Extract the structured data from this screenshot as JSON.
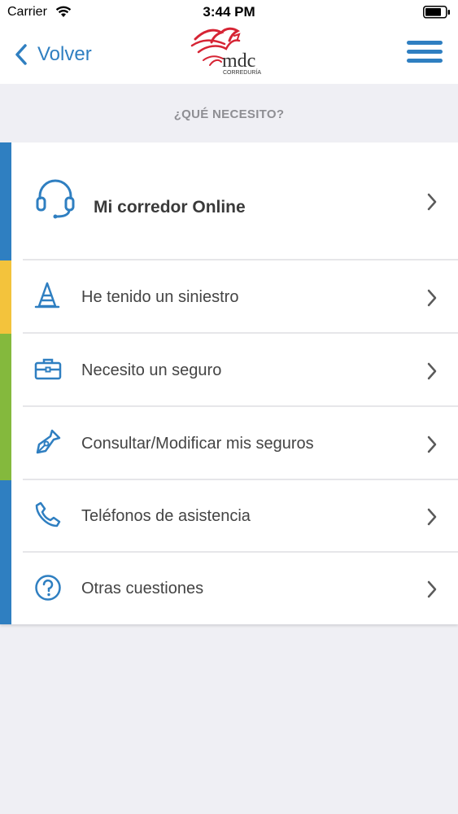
{
  "status_bar": {
    "carrier": "Carrier",
    "time": "3:44 PM"
  },
  "nav": {
    "back_label": "Volver",
    "logo_text": "mdc",
    "logo_subtext": "CORREDURÍA"
  },
  "section": {
    "title": "¿QUÉ NECESITO?"
  },
  "menu": {
    "items": [
      {
        "label": "Mi corredor Online",
        "icon": "headset-icon"
      },
      {
        "label": "He tenido un siniestro",
        "icon": "traffic-cone-icon"
      },
      {
        "label": "Necesito un seguro",
        "icon": "briefcase-icon"
      },
      {
        "label": "Consultar/Modificar mis seguros",
        "icon": "pen-nib-icon"
      },
      {
        "label": "Teléfonos de asistencia",
        "icon": "phone-icon"
      },
      {
        "label": "Otras cuestiones",
        "icon": "question-circle-icon"
      }
    ]
  },
  "colors": {
    "accent_blue": "#2f7fc1",
    "stripe_blue": "#2f7fc1",
    "stripe_yellow": "#f3c33c",
    "stripe_green": "#84b93d",
    "logo_red": "#d62434"
  }
}
